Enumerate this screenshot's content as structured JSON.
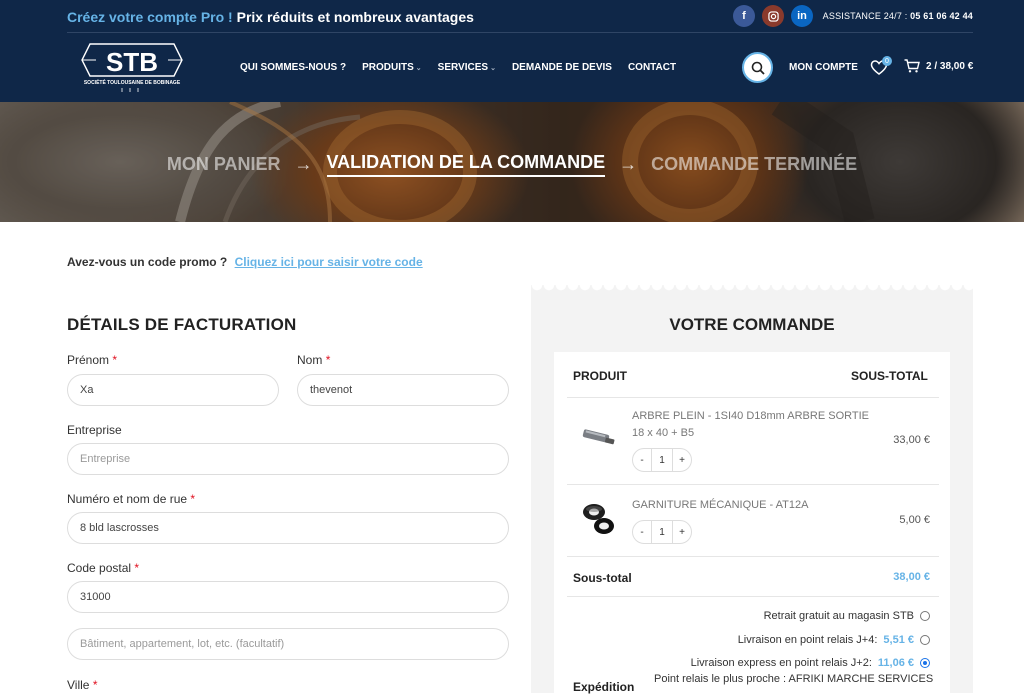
{
  "topbar": {
    "promo_accent": "Créez votre compte Pro !",
    "promo_text": "Prix réduits et nombreux avantages",
    "assist_label": "ASSISTANCE 24/7 :",
    "assist_phone": "05 61 06 42 44",
    "socials": [
      {
        "name": "facebook",
        "glyph": "f",
        "color": "#3b5998"
      },
      {
        "name": "instagram",
        "glyph": "◎",
        "color": "#8a3a2c"
      },
      {
        "name": "linkedin",
        "glyph": "in",
        "color": "#0a66c2"
      }
    ]
  },
  "logo": {
    "main": "STB",
    "sub": "SOCIÉTÉ TOULOUSAINE DE BOBINAGE"
  },
  "nav": [
    {
      "label": "QUI SOMMES-NOUS ?",
      "dropdown": false
    },
    {
      "label": "PRODUITS",
      "dropdown": true
    },
    {
      "label": "SERVICES",
      "dropdown": true
    },
    {
      "label": "DEMANDE DE DEVIS",
      "dropdown": false
    },
    {
      "label": "CONTACT",
      "dropdown": false
    }
  ],
  "header": {
    "account": "MON COMPTE",
    "wish_count": "0",
    "cart": "2 / 38,00 €"
  },
  "breadcrumb": {
    "step1": "MON PANIER",
    "step2": "VALIDATION DE LA COMMANDE",
    "step3": "COMMANDE TERMINÉE",
    "arrow": "→"
  },
  "coupon": {
    "question": "Avez-vous un code promo ?",
    "link": "Cliquez ici pour saisir votre code"
  },
  "billing": {
    "title": "DÉTAILS DE FACTURATION",
    "first_name_label": "Prénom",
    "first_name_value": "Xa",
    "last_name_label": "Nom",
    "last_name_value": "thevenot",
    "company_label": "Entreprise",
    "company_placeholder": "Entreprise",
    "street_label": "Numéro et nom de rue",
    "street_value": "8 bld lascrosses",
    "postcode_label": "Code postal",
    "postcode_value": "31000",
    "address2_placeholder": "Bâtiment, appartement, lot, etc. (facultatif)",
    "city_label": "Ville",
    "required_mark": "*"
  },
  "order": {
    "title": "VOTRE COMMANDE",
    "col_product": "PRODUIT",
    "col_subtotal": "SOUS-TOTAL",
    "items": [
      {
        "name": "ARBRE PLEIN - 1SI40 D18mm ARBRE SORTIE 18 x 40 + B5",
        "qty": "1",
        "price": "33,00 €",
        "minus": "-",
        "plus": "+"
      },
      {
        "name": "GARNITURE MÉCANIQUE - AT12A",
        "qty": "1",
        "price": "5,00 €",
        "minus": "-",
        "plus": "+"
      }
    ],
    "subtotal_label": "Sous-total",
    "subtotal_value": "38,00 €",
    "shipping_label": "Expédition",
    "shipping_options": [
      {
        "label": "Retrait gratuit au magasin STB",
        "fee": "",
        "selected": false
      },
      {
        "label": "Livraison en point relais J+4:",
        "fee": "5,51 €",
        "selected": false
      },
      {
        "label": "Livraison express en point relais J+2:",
        "fee": "11,06 €",
        "selected": true
      }
    ],
    "relay_text": "Point relais le plus proche : AFRIKI MARCHE SERVICES"
  }
}
